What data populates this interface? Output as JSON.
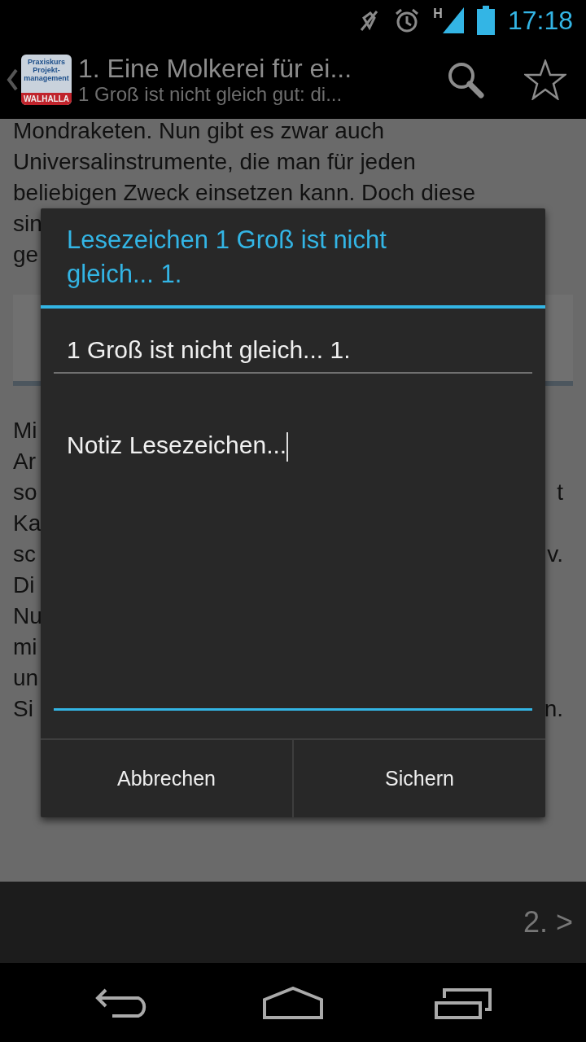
{
  "status_bar": {
    "network": "H",
    "time": "17:18"
  },
  "action_bar": {
    "app_icon": {
      "name": "Praxiskurs Projekt-management",
      "publisher": "WALHALLA"
    },
    "title": "1. Eine Molkerei für ei...",
    "subtitle": "1 Groß ist nicht gleich gut: di..."
  },
  "content": {
    "paragraph_1": [
      {
        "left": "Mondraketen. Nun gibt es zwar auch"
      },
      {
        "left": "Universalinstrumente, die man für jeden"
      },
      {
        "left": "beliebigen Zweck einsetzen kann. Doch diese"
      },
      {
        "left": "sin"
      },
      {
        "left": "ge"
      }
    ],
    "paragraph_2": [
      {
        "left": "Mi"
      },
      {
        "left": "Ar"
      },
      {
        "left": "so",
        "right": "t"
      },
      {
        "left": "Ka"
      },
      {
        "left": "sc",
        "right": "v."
      },
      {
        "left": "Di"
      },
      {
        "left": "Nu"
      },
      {
        "left": "mi"
      },
      {
        "left": "un"
      },
      {
        "left": "Si",
        "right": "n."
      }
    ]
  },
  "dialog": {
    "title": "Lesezeichen 1 Groß ist nicht gleich... 1.",
    "name_field": {
      "value": "1 Groß ist nicht gleich... 1.",
      "focused": false
    },
    "note_field": {
      "value": "Notiz Lesezeichen...",
      "focused": true
    },
    "buttons": [
      "Abbrechen",
      "Sichern"
    ]
  },
  "bottom_bar": {
    "next_page": "2. >"
  }
}
